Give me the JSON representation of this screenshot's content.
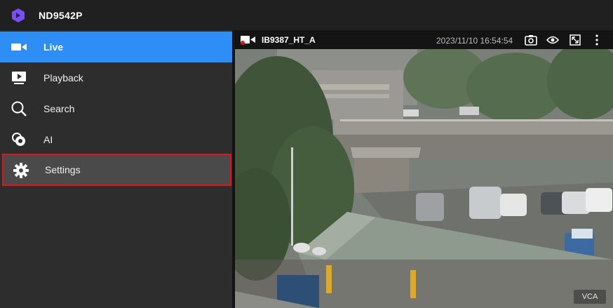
{
  "app": {
    "title": "ND9542P"
  },
  "sidebar": {
    "items": [
      {
        "label": "Live",
        "icon": "video-camera-icon",
        "state": "active"
      },
      {
        "label": "Playback",
        "icon": "playback-icon",
        "state": "normal"
      },
      {
        "label": "Search",
        "icon": "search-icon",
        "state": "normal"
      },
      {
        "label": "AI",
        "icon": "ai-icon",
        "state": "normal"
      },
      {
        "label": "Settings",
        "icon": "gear-icon",
        "state": "selected"
      }
    ]
  },
  "camera": {
    "name": "IB9387_HT_A",
    "timestamp": "2023/11/10 16:54:54",
    "badge": "VCA",
    "actions": [
      "snapshot-icon",
      "eye-icon",
      "fullscreen-icon",
      "more-icon"
    ]
  },
  "colors": {
    "active": "#2e8ef5",
    "selected_border": "#e0141e",
    "logo": "#7b4ef0",
    "recording_dot": "#e0141e"
  }
}
